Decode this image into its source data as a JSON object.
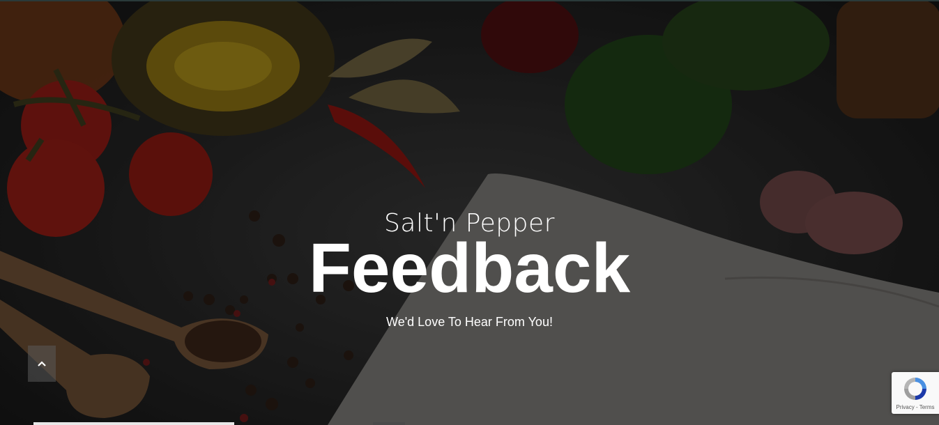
{
  "hero": {
    "brand": "Salt'n Pepper",
    "title": "Feedback",
    "subtitle": "We'd Love To Hear From You!"
  },
  "scroll_top": {
    "icon": "chevron-up-icon"
  },
  "recaptcha": {
    "privacy_label": "Privacy",
    "separator": "-",
    "terms_label": "Terms"
  },
  "colors": {
    "text": "#ffffff",
    "overlay": "#000000",
    "tomato": "#b3201a",
    "oil": "#c9a227",
    "herb": "#2f5a22",
    "wood": "#c49a6c",
    "book": "#e9e6e0"
  }
}
